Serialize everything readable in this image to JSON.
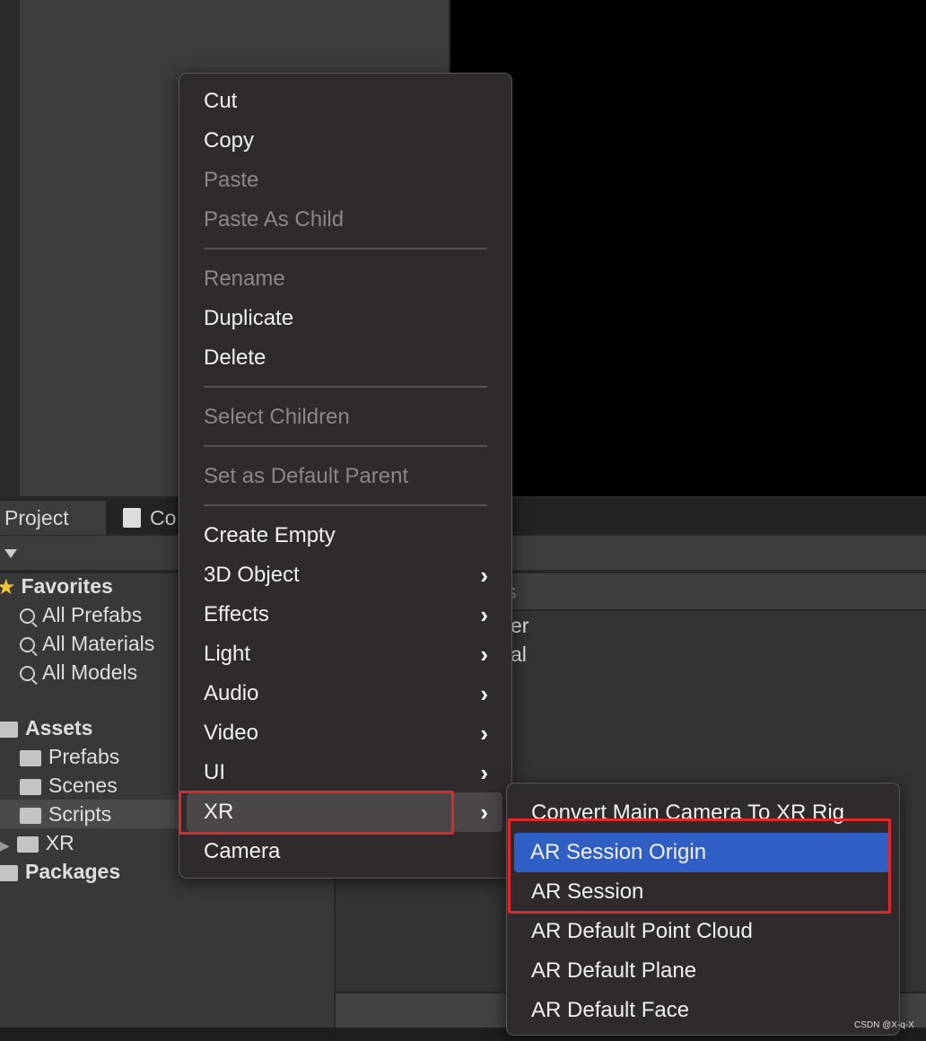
{
  "project_panel": {
    "tabs": [
      {
        "label": "Project",
        "icon": "project-icon"
      },
      {
        "label": "Co",
        "icon": "console-icon"
      }
    ],
    "tree": [
      {
        "label": "Favorites",
        "icon": "star-icon",
        "bold": true
      },
      {
        "label": "All Prefabs",
        "icon": "search-icon"
      },
      {
        "label": "All Materials",
        "icon": "search-icon"
      },
      {
        "label": "All Models",
        "icon": "search-icon"
      },
      {
        "label": "Assets",
        "icon": "folder-open-icon",
        "bold": true
      },
      {
        "label": "Prefabs",
        "icon": "folder-icon"
      },
      {
        "label": "Scenes",
        "icon": "folder-icon"
      },
      {
        "label": "Scripts",
        "icon": "folder-icon",
        "selected": true
      },
      {
        "label": "XR",
        "icon": "folder-icon"
      },
      {
        "label": "Packages",
        "icon": "folder-icon",
        "bold": true
      }
    ],
    "right_header_partial": "s",
    "right_items_partial": [
      "er",
      "al"
    ]
  },
  "context_menu": {
    "items": [
      "Cut",
      "Copy",
      "Paste",
      "Paste As Child",
      "Rename",
      "Duplicate",
      "Delete",
      "Select Children",
      "Set as Default Parent",
      "Create Empty",
      "3D Object",
      "Effects",
      "Light",
      "Audio",
      "Video",
      "UI",
      "XR",
      "Camera"
    ],
    "disabled": [
      "Paste",
      "Paste As Child",
      "Rename",
      "Select Children",
      "Set as Default Parent"
    ],
    "highlighted": "XR"
  },
  "xr_submenu": {
    "items": [
      "Convert Main Camera To XR Rig",
      "AR Session Origin",
      "AR Session",
      "AR Default Point Cloud",
      "AR Default Plane",
      "AR Default Face"
    ],
    "selected": "AR Session Origin"
  },
  "watermark": "CSDN @X-q-X",
  "colors": {
    "menu_bg": "#2f2b2c",
    "selection_blue": "#2f5fc4",
    "annotation_red": "#e0282a",
    "hover": "#4b4647"
  }
}
